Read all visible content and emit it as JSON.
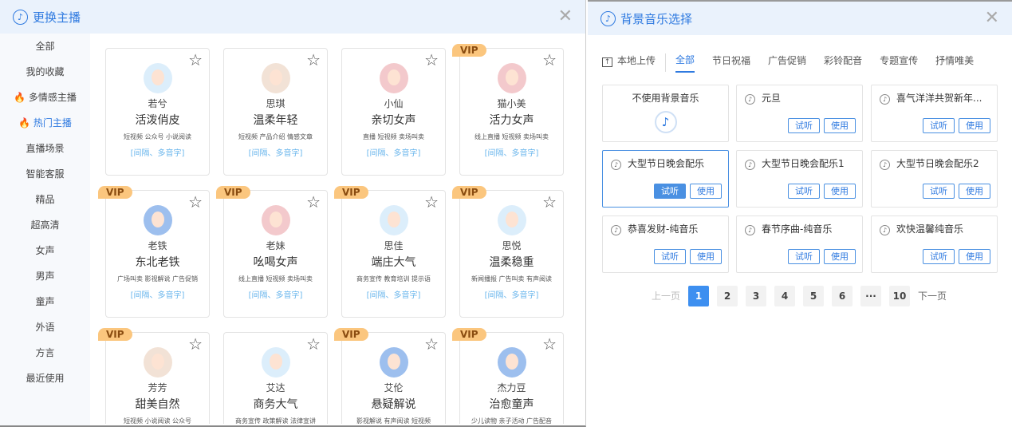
{
  "left": {
    "title": "更换主播",
    "sidebar": [
      "全部",
      "我的收藏",
      "多情感主播",
      "热门主播",
      "直播场景",
      "智能客服",
      "精品",
      "超高清",
      "女声",
      "男声",
      "童声",
      "外语",
      "方言",
      "最近使用"
    ],
    "active": "热门主播",
    "vip_label": "VIP",
    "anchors": [
      {
        "name": "若兮",
        "style": "活泼俏皮",
        "tags": "短视频 公众号 小说阅读",
        "feat": "[间隔、多音字]",
        "vip": false,
        "color": "#dceefb"
      },
      {
        "name": "思琪",
        "style": "温柔年轻",
        "tags": "短视频 产品介绍 情感文章",
        "feat": "[间隔、多音字]",
        "vip": false,
        "color": "#f2e2d6"
      },
      {
        "name": "小仙",
        "style": "亲切女声",
        "tags": "直播 短视频 卖场叫卖",
        "feat": "[间隔、多音字]",
        "vip": false,
        "color": "#f3c9cc"
      },
      {
        "name": "猫小美",
        "style": "活力女声",
        "tags": "线上直播 短视频 卖场叫卖",
        "feat": "[间隔、多音字]",
        "vip": true,
        "color": "#f3c9cc"
      },
      {
        "name": "老铁",
        "style": "东北老铁",
        "tags": "广场叫卖 影视解说 广告促销",
        "feat": "[间隔、多音字]",
        "vip": true,
        "color": "#9dbfee"
      },
      {
        "name": "老妹",
        "style": "吆喝女声",
        "tags": "线上直播 短视频 卖场叫卖",
        "feat": "[间隔、多音字]",
        "vip": true,
        "color": "#f3c9cc"
      },
      {
        "name": "思佳",
        "style": "端庄大气",
        "tags": "商务宣传 教育培训 提示语",
        "feat": "[间隔、多音字]",
        "vip": true,
        "color": "#dceefb"
      },
      {
        "name": "思悦",
        "style": "温柔稳重",
        "tags": "新闻播报 广告叫卖 有声阅读",
        "feat": "[间隔、多音字]",
        "vip": true,
        "color": "#dceefb"
      },
      {
        "name": "芳芳",
        "style": "甜美自然",
        "tags": "短视频 小说阅读 公众号",
        "feat": "",
        "vip": true,
        "color": "#f2e2d6"
      },
      {
        "name": "艾达",
        "style": "商务大气",
        "tags": "商务宣传 政策解读 法律宣讲",
        "feat": "",
        "vip": false,
        "color": "#dceefb"
      },
      {
        "name": "艾伦",
        "style": "悬疑解说",
        "tags": "影视解说 有声阅读 短视频",
        "feat": "",
        "vip": true,
        "color": "#9dbfee"
      },
      {
        "name": "杰力豆",
        "style": "治愈童声",
        "tags": "少儿读物 亲子活动 广告配音",
        "feat": "",
        "vip": true,
        "color": "#9dbfee"
      }
    ]
  },
  "right": {
    "title": "背景音乐选择",
    "upload": "本地上传",
    "tabs": [
      "全部",
      "节日祝福",
      "广告促销",
      "彩铃配音",
      "专题宣传",
      "抒情唯美"
    ],
    "none_label": "不使用背景音乐",
    "listen": "试听",
    "use": "使用",
    "tracks": [
      "元旦",
      "喜气洋洋共贺新年...",
      "大型节日晚会配乐",
      "大型节日晚会配乐1",
      "大型节日晚会配乐2",
      "恭喜发财-纯音乐",
      "春节序曲-纯音乐",
      "欢快温馨纯音乐"
    ],
    "pagination": {
      "prev": "上一页",
      "pages": [
        "1",
        "2",
        "3",
        "4",
        "5",
        "6",
        "···",
        "10"
      ],
      "current": "1",
      "next": "下一页"
    }
  },
  "colors": {
    "accent": "#2f7ae0",
    "vip": "#fbc67e"
  }
}
